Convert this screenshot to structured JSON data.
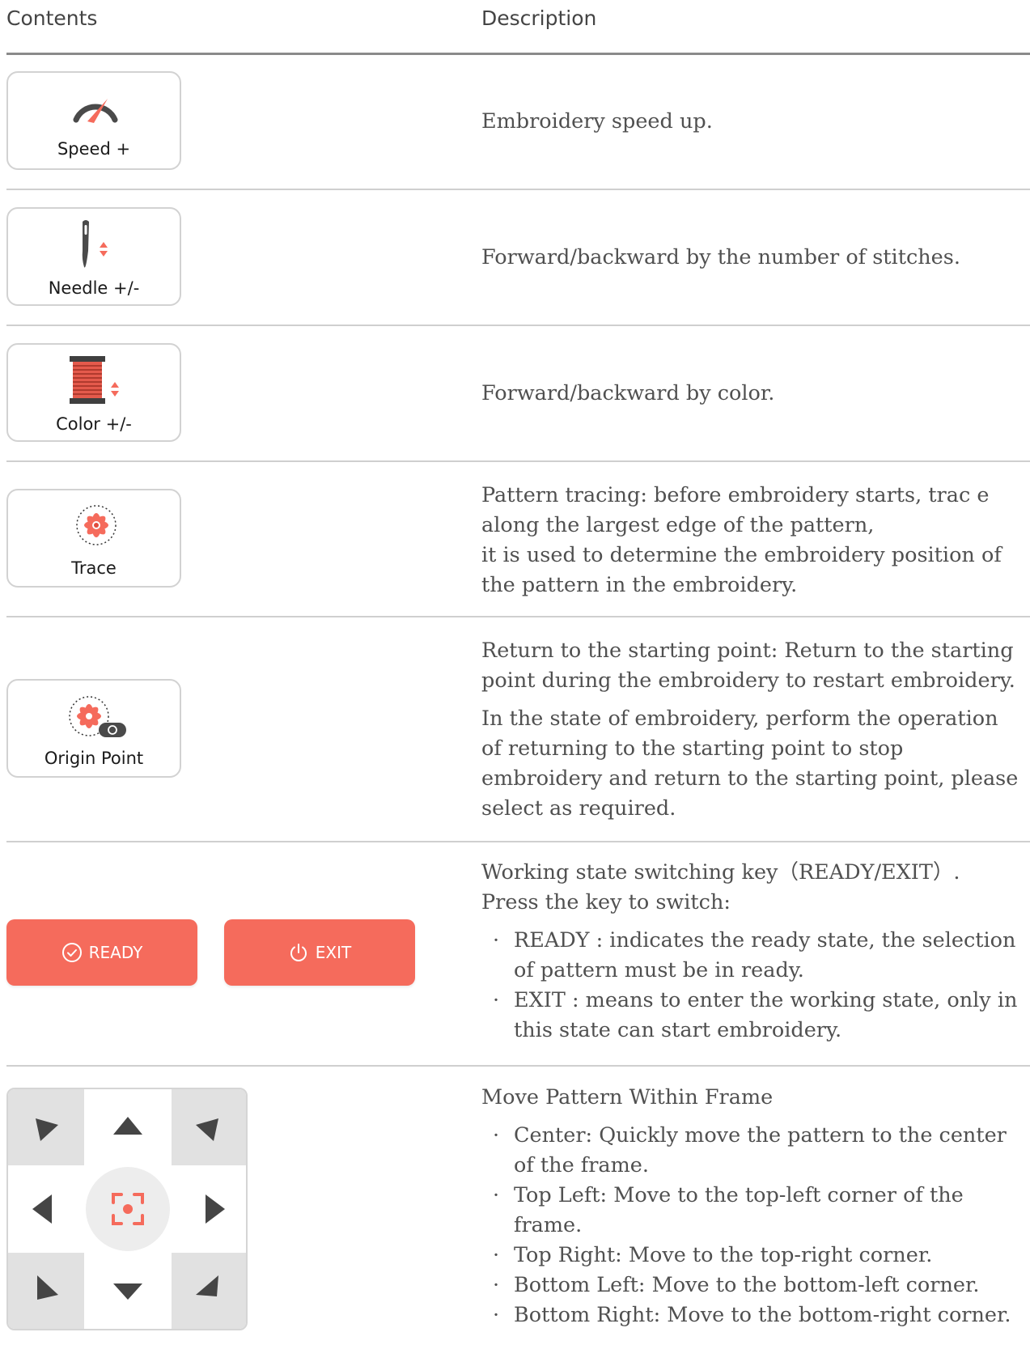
{
  "header": {
    "col1": "Contents",
    "col2": "Description"
  },
  "rows": [
    {
      "label": "Speed +",
      "icon": "speedometer-icon",
      "desc": "Embroidery speed up."
    },
    {
      "label": "Needle +/-",
      "icon": "needle-icon",
      "desc": "Forward/backward by the number of stitches."
    },
    {
      "label": "Color +/-",
      "icon": "thread-spool-icon",
      "desc": "Forward/backward by color."
    },
    {
      "label": "Trace",
      "icon": "flower-pattern-icon",
      "desc": [
        "Pattern tracing: before embroidery starts, trac e",
        "along the largest edge of the pattern,",
        "it is used to determine the embroidery position of",
        "the pattern in the embroidery."
      ]
    },
    {
      "label": "Origin Point",
      "icon": "flower-origin-icon",
      "desc1": [
        "Return to the starting point: Return to the starting",
        "point during the embroidery to restart embroidery."
      ],
      "desc2": [
        "In the state of embroidery, perform the operation",
        "of returning to the starting point to stop",
        "embroidery and return to the starting point, please",
        "select as required."
      ]
    }
  ],
  "ready_exit": {
    "ready_label": "READY",
    "exit_label": "EXIT",
    "intro": [
      "Working state switching key（READY/EXIT）.",
      "Press the key to switch:"
    ],
    "bullets": [
      [
        "READY : indicates the ready state, the selection",
        "of pattern must be in ready."
      ],
      [
        "EXIT : means to enter the working state, only in",
        "this state can start embroidery."
      ]
    ]
  },
  "move": {
    "title": "Move Pattern Within Frame",
    "bullets": [
      [
        "Center: Quickly move the pattern to the center",
        "of the frame."
      ],
      [
        "Top Left: Move to the top-left corner of the",
        "frame."
      ],
      [
        "Top Right: Move to the top-right corner."
      ],
      [
        "Bottom Left: Move to the bottom-left corner."
      ],
      [
        "Bottom Right: Move to the bottom-right corner."
      ]
    ]
  },
  "bullet_char": "·",
  "colors": {
    "accent": "#f56b5c",
    "icon_dark": "#4a4a4a",
    "corner_bg": "#e1e1e1"
  }
}
